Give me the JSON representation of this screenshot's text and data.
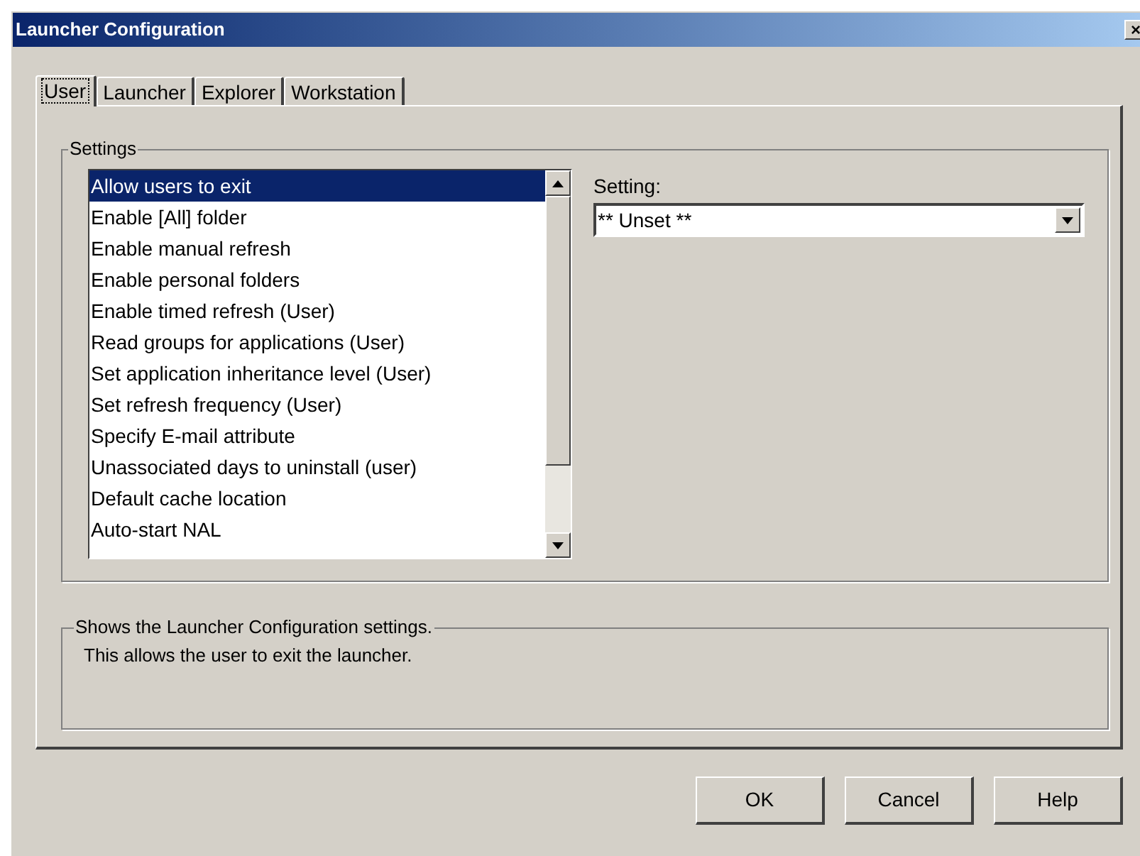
{
  "window": {
    "title": "Launcher Configuration",
    "close": "×"
  },
  "tabs": [
    {
      "label": "User",
      "selected": true
    },
    {
      "label": "Launcher",
      "selected": false
    },
    {
      "label": "Explorer",
      "selected": false
    },
    {
      "label": "Workstation",
      "selected": false
    }
  ],
  "settings_group": {
    "title": "Settings",
    "items": [
      {
        "label": "Allow users to exit",
        "selected": true
      },
      {
        "label": "Enable [All] folder",
        "selected": false
      },
      {
        "label": "Enable manual refresh",
        "selected": false
      },
      {
        "label": "Enable personal folders",
        "selected": false
      },
      {
        "label": "Enable timed refresh (User)",
        "selected": false
      },
      {
        "label": "Read groups for applications (User)",
        "selected": false
      },
      {
        "label": "Set application inheritance level (User)",
        "selected": false
      },
      {
        "label": "Set refresh frequency (User)",
        "selected": false
      },
      {
        "label": "Specify E-mail attribute",
        "selected": false
      },
      {
        "label": "Unassociated days to uninstall (user)",
        "selected": false
      },
      {
        "label": "Default cache location",
        "selected": false
      },
      {
        "label": "Auto-start NAL",
        "selected": false
      }
    ],
    "setting_label": "Setting:",
    "setting_value": "** Unset **"
  },
  "description_group": {
    "title": "Shows the Launcher Configuration settings.",
    "text": "This allows the user to exit the launcher."
  },
  "buttons": [
    "OK",
    "Cancel",
    "Help"
  ]
}
